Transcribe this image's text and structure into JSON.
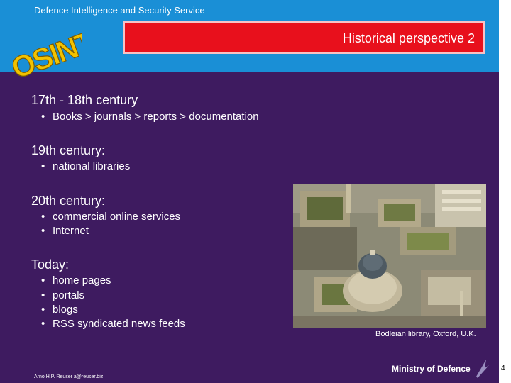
{
  "header": {
    "org": "Defence Intelligence and Security Service",
    "title": "Historical perspective 2",
    "logo_text": "OSINT"
  },
  "sections": [
    {
      "heading": "17th - 18th century",
      "bullets": [
        "Books  >  journals  >  reports  >  documentation"
      ]
    },
    {
      "heading": "19th century:",
      "bullets": [
        "national libraries"
      ]
    },
    {
      "heading": "20th century:",
      "bullets": [
        "commercial online services",
        "Internet"
      ]
    },
    {
      "heading": "Today:",
      "bullets": [
        "home pages",
        "portals",
        "blogs",
        "RSS syndicated news feeds"
      ]
    }
  ],
  "image": {
    "caption": "Bodleian library, Oxford, U.K."
  },
  "footer": {
    "author": "Arno H.P. Reuser a@reuser.biz",
    "ministry": "Ministry of Defence",
    "page_number": "4"
  },
  "colors": {
    "background": "#3e1b60",
    "header_band": "#1a8fd6",
    "title_box": "#e8101c",
    "logo": "#f2c200"
  }
}
